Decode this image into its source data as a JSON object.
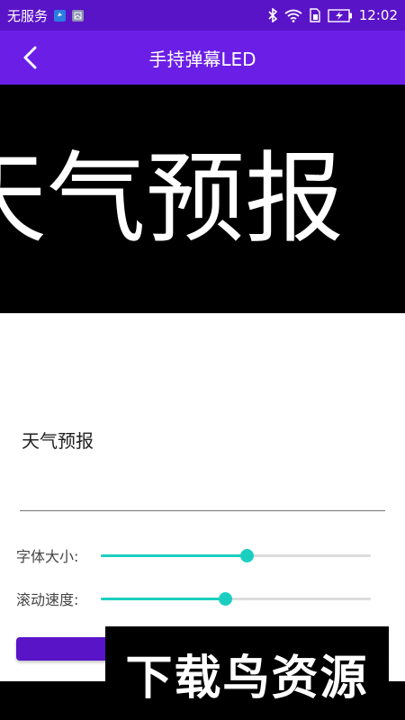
{
  "status_bar": {
    "carrier": "无服务",
    "time": "12:02"
  },
  "title_bar": {
    "title": "手持弹幕LED"
  },
  "led": {
    "scrolling_text": "天气预报"
  },
  "input": {
    "value": "天气预报"
  },
  "controls": {
    "font_size_label": "字体大小:",
    "font_size_value": 0.54,
    "scroll_speed_label": "滚动速度:",
    "scroll_speed_value": 0.46
  },
  "watermark": {
    "text": "下载鸟资源"
  },
  "colors": {
    "status_bar": "#5a14c8",
    "title_bar": "#6a1ee6",
    "slider_accent": "#1bcfc0"
  }
}
